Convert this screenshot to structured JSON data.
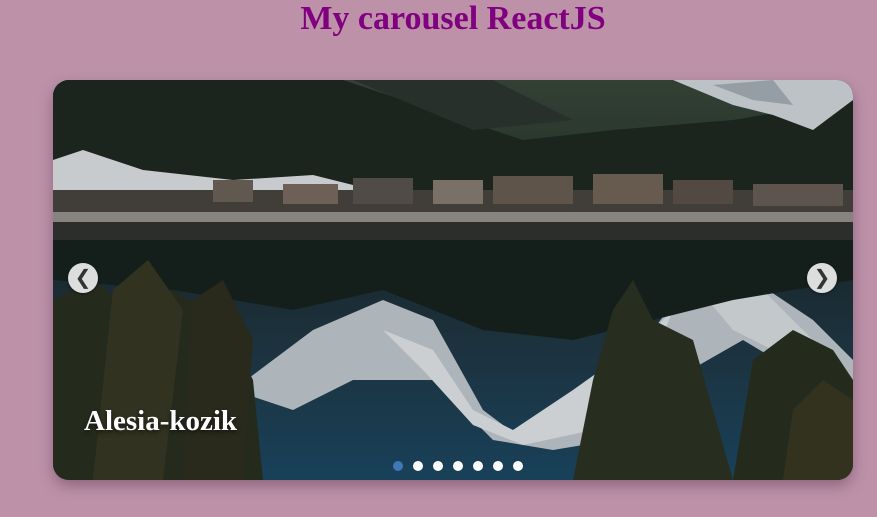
{
  "page": {
    "title": "My carousel ReactJS",
    "title_color": "#800080",
    "background_color": "#bd92a9"
  },
  "carousel": {
    "caption": "Alesia-kozik",
    "prev_icon": "chevron-left-icon",
    "next_icon": "chevron-right-icon",
    "prev_glyph": "❮",
    "next_glyph": "❯",
    "slide_count": 7,
    "active_index": 0,
    "active_dot_color": "#3f78b8",
    "dot_color": "#ffffff"
  }
}
